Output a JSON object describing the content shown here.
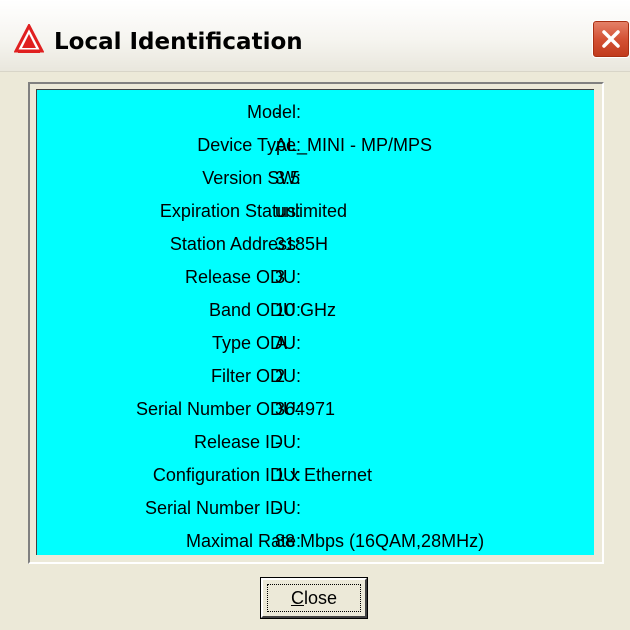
{
  "window": {
    "title": "Local Identification",
    "app_icon": "warning-triangle-logo-icon",
    "close_icon": "close-icon",
    "accent_color": "#d45235",
    "panel_color": "#00ffff"
  },
  "info": [
    {
      "label": "Model:",
      "value": "-"
    },
    {
      "label": "Device Type:",
      "value": "AL_MINI - MP/MPS"
    },
    {
      "label": "Version SW:",
      "value": "3.5"
    },
    {
      "label": "Expiration Status:",
      "value": "unlimited"
    },
    {
      "label": "Station Address:",
      "value": "3185H"
    },
    {
      "label": "Release ODU:",
      "value": "3"
    },
    {
      "label": "Band ODU:",
      "value": "10 GHz"
    },
    {
      "label": "Type ODU:",
      "value": "A"
    },
    {
      "label": "Filter ODU:",
      "value": "2"
    },
    {
      "label": "Serial Number ODU:",
      "value": "364971"
    },
    {
      "label": "Release IDU:",
      "value": "-"
    },
    {
      "label": "Configuration IDU:",
      "value": "1 x Ethernet"
    },
    {
      "label": "Serial Number IDU:",
      "value": "-"
    },
    {
      "label": "Maximal Rate:",
      "value": "88 Mbps (16QAM,28MHz)"
    }
  ],
  "buttons": {
    "close_first": "C",
    "close_rest": "lose"
  }
}
